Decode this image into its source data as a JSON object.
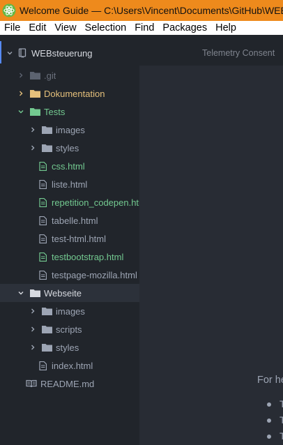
{
  "window": {
    "title": "Welcome Guide — C:\\Users\\Vincent\\Documents\\GitHub\\WEBsteuerung — Atom",
    "icon": "atom-icon",
    "accent_color": "#ee8a1c"
  },
  "menubar": {
    "items": [
      "File",
      "Edit",
      "View",
      "Selection",
      "Find",
      "Packages",
      "Help"
    ]
  },
  "tree": {
    "project_name": "WEBsteuerung",
    "items": [
      {
        "label": ".git",
        "kind": "folder",
        "state": "collapsed",
        "status": "ignored"
      },
      {
        "label": "Dokumentation",
        "kind": "folder",
        "state": "collapsed",
        "status": "modified"
      },
      {
        "label": "Tests",
        "kind": "folder",
        "state": "expanded",
        "status": "added"
      },
      {
        "label": "images",
        "kind": "folder",
        "state": "collapsed"
      },
      {
        "label": "styles",
        "kind": "folder",
        "state": "collapsed"
      },
      {
        "label": "css.html",
        "kind": "file",
        "status": "added"
      },
      {
        "label": "liste.html",
        "kind": "file"
      },
      {
        "label": "repetition_codepen.html",
        "kind": "file",
        "status": "added"
      },
      {
        "label": "tabelle.html",
        "kind": "file"
      },
      {
        "label": "test-html.html",
        "kind": "file"
      },
      {
        "label": "testbootstrap.html",
        "kind": "file",
        "status": "added"
      },
      {
        "label": "testpage-mozilla.html",
        "kind": "file"
      },
      {
        "label": "Webseite",
        "kind": "folder",
        "state": "expanded",
        "selected": true
      },
      {
        "label": "images",
        "kind": "folder",
        "state": "collapsed"
      },
      {
        "label": "scripts",
        "kind": "folder",
        "state": "collapsed"
      },
      {
        "label": "styles",
        "kind": "folder",
        "state": "collapsed"
      },
      {
        "label": "index.html",
        "kind": "file"
      },
      {
        "label": "README.md",
        "kind": "markdown"
      }
    ]
  },
  "tabs": {
    "active": "Telemetry Consent"
  },
  "editor": {
    "help_text": "For help",
    "bullets": [
      "T",
      "T",
      "T"
    ]
  }
}
